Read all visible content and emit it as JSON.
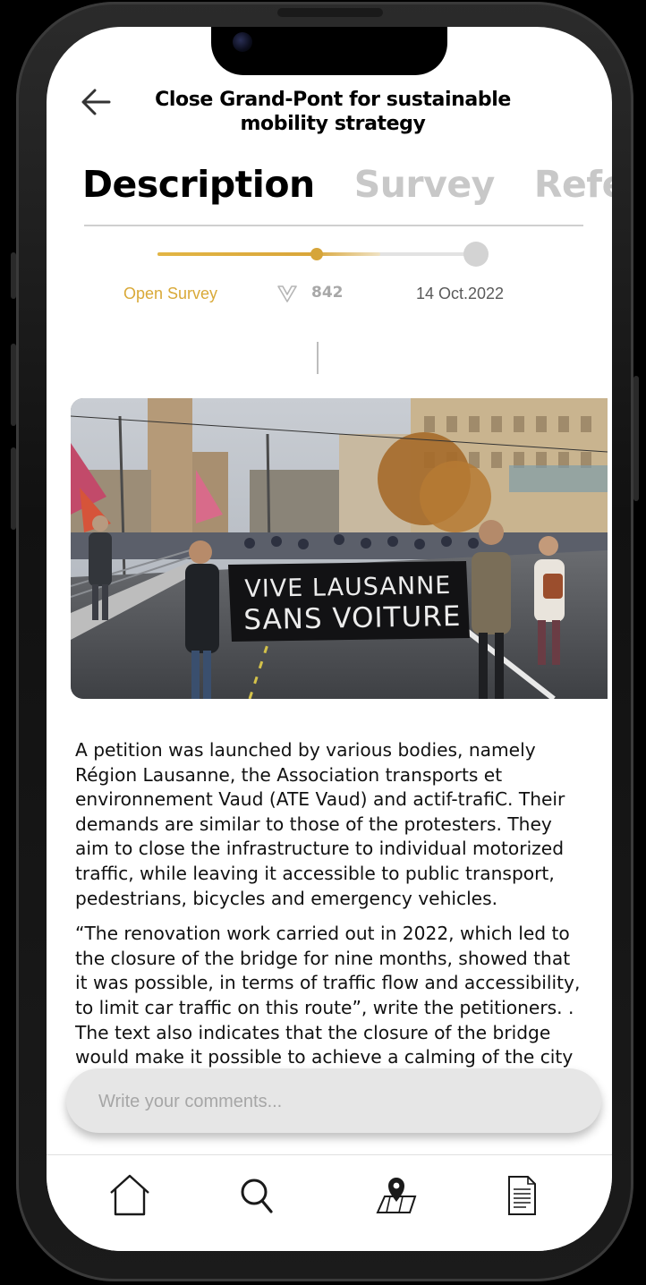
{
  "header": {
    "title_line1": "Close Grand-Pont for sustainable",
    "title_line2": "mobility strategy",
    "back_icon": "arrow-left-icon"
  },
  "tabs": [
    {
      "label": "Description",
      "active": true
    },
    {
      "label": "Survey",
      "active": false
    },
    {
      "label": "Refer",
      "active": false
    }
  ],
  "progress": {
    "fraction": 0.5,
    "fill_color": "#d9a63a",
    "status_label": "Open Survey",
    "vote_icon": "v-vote-icon",
    "vote_count": "842",
    "date": "14 Oct.2022"
  },
  "photo": {
    "banner_line1": "VIVE LAUSANNE",
    "banner_line2": "SANS VOITURE"
  },
  "article": {
    "paragraphs": [
      "A petition was launched by various bodies, namely Région Lausanne, the Association transports et environnement Vaud (ATE Vaud) and actif-trafiC. Their demands are similar to those of the protesters. They aim to close the infrastructure to individual motorized traffic, while leaving it accessible to public transport, pedestrians, bicycles and emergency vehicles.",
      "“The renovation work carried out in 2022, which led to the closure of the bridge for nine months, showed that it was possible, in terms of traffic flow and accessibility, to limit car traffic on this route”, write the petitioners. . The text also indicates that the closure of the bridge would make it possible to achieve a calming of the city center"
    ]
  },
  "comment": {
    "placeholder": "Write your comments..."
  },
  "nav": [
    {
      "name": "home-icon"
    },
    {
      "name": "search-icon"
    },
    {
      "name": "map-pin-icon"
    },
    {
      "name": "document-icon"
    }
  ],
  "colors": {
    "accent": "#d9a938",
    "inactive_tab": "#c8c8c8",
    "comment_bg": "#e6e6e6"
  }
}
